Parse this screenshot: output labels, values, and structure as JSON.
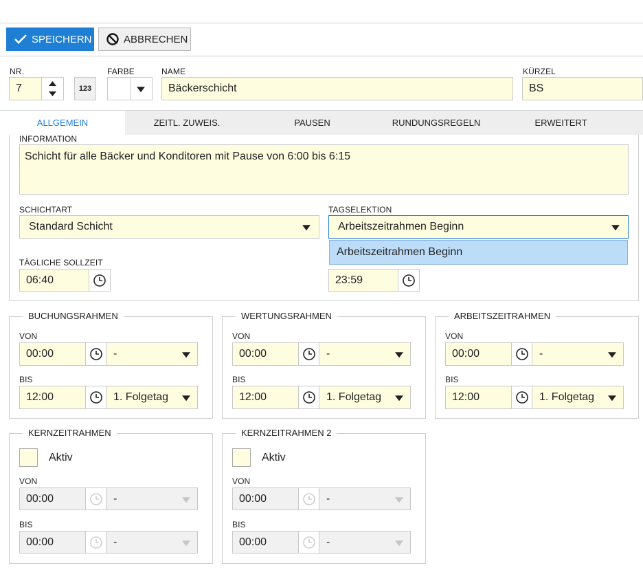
{
  "toolbar": {
    "save_label": "SPEICHERN",
    "cancel_label": "ABBRECHEN"
  },
  "header": {
    "nr_label": "NR.",
    "nr_value": "7",
    "numfmt_label": "123",
    "farbe_label": "FARBE",
    "name_label": "NAME",
    "name_value": "Bäckerschicht",
    "kuerzel_label": "KÜRZEL",
    "kuerzel_value": "BS"
  },
  "tabs": [
    {
      "label": "ALLGEMEIN",
      "active": true
    },
    {
      "label": "ZEITL. ZUWEIS."
    },
    {
      "label": "PAUSEN"
    },
    {
      "label": "RUNDUNGSREGELN"
    },
    {
      "label": "ERWEITERT"
    }
  ],
  "general": {
    "information_label": "INFORMATION",
    "information_value": "Schicht für alle Bäcker und Konditoren mit Pause von 6:00 bis 6:15",
    "schichtart_label": "SCHICHTART",
    "schichtart_value": "Standard Schicht",
    "tagselektion_label": "TAGSELEKTION",
    "tagselektion_value": "Arbeitszeitrahmen Beginn",
    "tagselektion_option": "Arbeitszeitrahmen Beginn",
    "sollzeit_label": "TÄGLICHE SOLLZEIT",
    "sollzeit_value": "06:40",
    "tagesgrenze_value": "23:59"
  },
  "frames": [
    {
      "title": "BUCHUNGSRAHMEN",
      "von_label": "VON",
      "von_time": "00:00",
      "von_day": "-",
      "bis_label": "BIS",
      "bis_time": "12:00",
      "bis_day": "1. Folgetag"
    },
    {
      "title": "WERTUNGSRAHMEN",
      "von_label": "VON",
      "von_time": "00:00",
      "von_day": "-",
      "bis_label": "BIS",
      "bis_time": "12:00",
      "bis_day": "1. Folgetag"
    },
    {
      "title": "ARBEITSZEITRAHMEN",
      "von_label": "VON",
      "von_time": "00:00",
      "von_day": "-",
      "bis_label": "BIS",
      "bis_time": "12:00",
      "bis_day": "1. Folgetag"
    }
  ],
  "core_frames": [
    {
      "title": "KERNZEITRAHMEN",
      "aktiv_label": "Aktiv",
      "von_label": "VON",
      "von_time": "00:00",
      "von_day": "-",
      "bis_label": "BIS",
      "bis_time": "00:00",
      "bis_day": "-"
    },
    {
      "title": "KERNZEITRAHMEN 2",
      "aktiv_label": "Aktiv",
      "von_label": "VON",
      "von_time": "00:00",
      "von_day": "-",
      "bis_label": "BIS",
      "bis_time": "00:00",
      "bis_day": "-"
    }
  ],
  "colors": {
    "accent": "#1f7fd4",
    "input_bg": "#fffde0",
    "disabled_bg": "#f1f1f1",
    "dropdown_highlight": "#bcdcf7"
  }
}
